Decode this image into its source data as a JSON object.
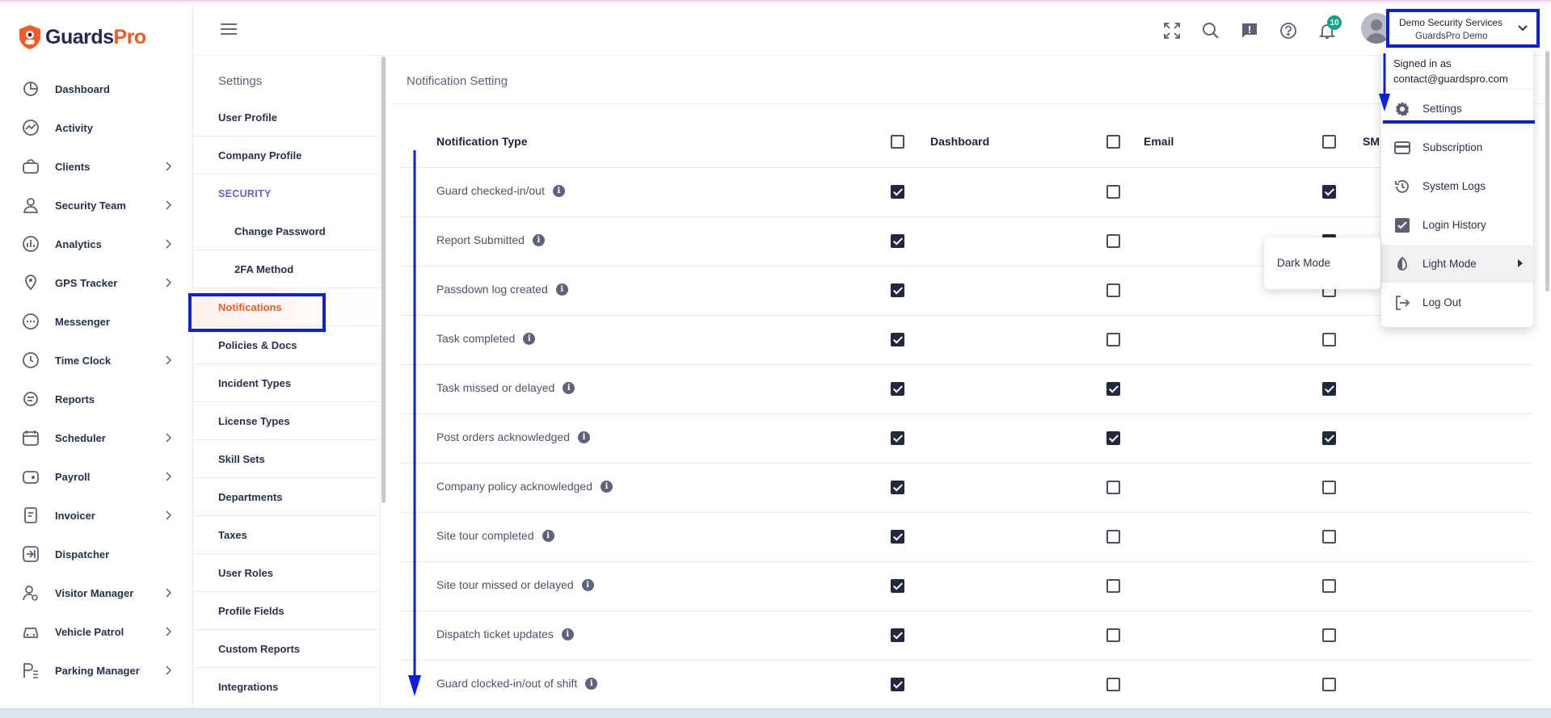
{
  "brand": {
    "name_main": "Guards",
    "name_accent": "Pro"
  },
  "nav": [
    {
      "label": "Dashboard",
      "icon": "dashboard-icon",
      "chevron": false
    },
    {
      "label": "Activity",
      "icon": "activity-icon",
      "chevron": false
    },
    {
      "label": "Clients",
      "icon": "clients-icon",
      "chevron": true
    },
    {
      "label": "Security Team",
      "icon": "security-team-icon",
      "chevron": true
    },
    {
      "label": "Analytics",
      "icon": "analytics-icon",
      "chevron": true
    },
    {
      "label": "GPS Tracker",
      "icon": "gps-icon",
      "chevron": true
    },
    {
      "label": "Messenger",
      "icon": "messenger-icon",
      "chevron": false
    },
    {
      "label": "Time Clock",
      "icon": "clock-icon",
      "chevron": true
    },
    {
      "label": "Reports",
      "icon": "reports-icon",
      "chevron": false
    },
    {
      "label": "Scheduler",
      "icon": "calendar-icon",
      "chevron": true
    },
    {
      "label": "Payroll",
      "icon": "payroll-icon",
      "chevron": true
    },
    {
      "label": "Invoicer",
      "icon": "invoice-icon",
      "chevron": true
    },
    {
      "label": "Dispatcher",
      "icon": "dispatcher-icon",
      "chevron": false
    },
    {
      "label": "Visitor Manager",
      "icon": "visitor-icon",
      "chevron": true
    },
    {
      "label": "Vehicle Patrol",
      "icon": "car-icon",
      "chevron": true
    },
    {
      "label": "Parking Manager",
      "icon": "parking-icon",
      "chevron": true
    }
  ],
  "settings": {
    "title": "Settings",
    "items": [
      {
        "label": "User Profile",
        "kind": "item"
      },
      {
        "label": "Company Profile",
        "kind": "item"
      },
      {
        "label": "SECURITY",
        "kind": "section"
      },
      {
        "label": "Change Password",
        "kind": "sub"
      },
      {
        "label": "2FA Method",
        "kind": "sub"
      },
      {
        "label": "Notifications",
        "kind": "active"
      },
      {
        "label": "Policies & Docs",
        "kind": "item"
      },
      {
        "label": "Incident Types",
        "kind": "item"
      },
      {
        "label": "License Types",
        "kind": "item"
      },
      {
        "label": "Skill Sets",
        "kind": "item"
      },
      {
        "label": "Departments",
        "kind": "item"
      },
      {
        "label": "Taxes",
        "kind": "item"
      },
      {
        "label": "User Roles",
        "kind": "item"
      },
      {
        "label": "Profile Fields",
        "kind": "item"
      },
      {
        "label": "Custom Reports",
        "kind": "item"
      },
      {
        "label": "Integrations",
        "kind": "item"
      }
    ]
  },
  "main": {
    "title": "Notification Setting",
    "headers": {
      "type": "Notification Type",
      "dashboard": "Dashboard",
      "email": "Email",
      "sms": "SM"
    },
    "header_checks": {
      "dashboard": false,
      "email": false,
      "sms": false
    },
    "rows": [
      {
        "label": "Guard checked-in/out",
        "dashboard": true,
        "email": false,
        "sms": true
      },
      {
        "label": "Report Submitted",
        "dashboard": true,
        "email": false,
        "sms": true
      },
      {
        "label": "Passdown log created",
        "dashboard": true,
        "email": false,
        "sms": false
      },
      {
        "label": "Task completed",
        "dashboard": true,
        "email": false,
        "sms": false
      },
      {
        "label": "Task missed or delayed",
        "dashboard": true,
        "email": true,
        "sms": true
      },
      {
        "label": "Post orders acknowledged",
        "dashboard": true,
        "email": true,
        "sms": true
      },
      {
        "label": "Company policy acknowledged",
        "dashboard": true,
        "email": false,
        "sms": false
      },
      {
        "label": "Site tour completed",
        "dashboard": true,
        "email": false,
        "sms": false
      },
      {
        "label": "Site tour missed or delayed",
        "dashboard": true,
        "email": false,
        "sms": false
      },
      {
        "label": "Dispatch ticket updates",
        "dashboard": true,
        "email": false,
        "sms": false
      },
      {
        "label": "Guard clocked-in/out of shift",
        "dashboard": true,
        "email": false,
        "sms": false
      }
    ]
  },
  "topbar": {
    "notification_count": "10",
    "account": {
      "company": "Demo Security Services",
      "user": "GuardsPro Demo"
    }
  },
  "dropdown": {
    "signed_in_as": "Signed in as",
    "email": "contact@guardspro.com",
    "items": [
      {
        "label": "Settings",
        "icon": "gear-icon"
      },
      {
        "label": "Subscription",
        "icon": "credit-card-icon"
      },
      {
        "label": "System Logs",
        "icon": "history-icon"
      },
      {
        "label": "Login History",
        "icon": "checkbox-icon"
      },
      {
        "label": "Light Mode",
        "icon": "contrast-icon"
      },
      {
        "label": "Log Out",
        "icon": "logout-icon"
      }
    ],
    "submenu": {
      "label": "Dark Mode"
    }
  },
  "colors": {
    "accent": "#f15a24",
    "annotation": "#0a1fe0",
    "badge": "#14a487",
    "section": "#6b5fd4"
  }
}
